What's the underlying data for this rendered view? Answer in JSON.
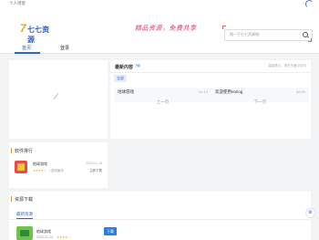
{
  "topbar": {
    "brand": "个人博客"
  },
  "header": {
    "logo_text": "七七资源",
    "slogan": "精品资源，免费共享",
    "search_placeholder": "搜一下七七资源吧!"
  },
  "nav": {
    "items": [
      "首页",
      "登录"
    ]
  },
  "latest": {
    "title": "最新内容",
    "badge": "+8",
    "more": "温馨提示，请在页面中访问",
    "tab_chip": "全部",
    "left": {
      "name": "地球游戏",
      "date": "01-14",
      "pager": "上一页"
    },
    "right": {
      "name": "欢迎使用emlog",
      "date": "00:00",
      "pager": "下一页"
    }
  },
  "rank": {
    "title": "软件排行",
    "app": {
      "name": "地球游戏",
      "stars": "★★★★☆",
      "category": "/ 游戏娱乐",
      "date": "2023-01-16",
      "action": "立即下载"
    }
  },
  "downloads": {
    "title": "资源下载",
    "tab": "最新资源",
    "app": {
      "name": "地球游戏",
      "meta": "2023-01-14",
      "stars": "★★★★☆",
      "button": "下载"
    }
  },
  "float_icon": "settings-icon"
}
